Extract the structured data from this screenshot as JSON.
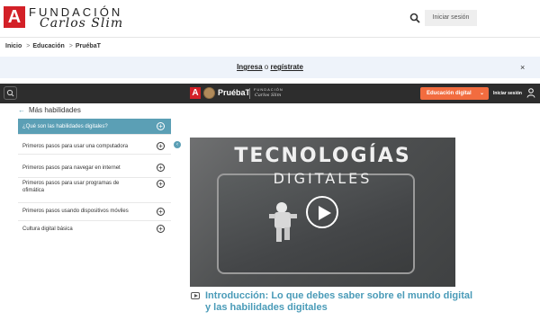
{
  "header": {
    "logo_letter": "A",
    "logo_line1": "FUNDACIÓN",
    "logo_line2": "Carlos Slim",
    "login_label": "Iniciar sesión"
  },
  "breadcrumb": [
    "Inicio",
    "Educación",
    "PruébaT"
  ],
  "banner": {
    "ingresa": "Ingresa",
    "o": "o",
    "registrate": "regístrate",
    "close": "×"
  },
  "nav": {
    "logo_letter": "A",
    "brand": "PruébaT",
    "fund_line1": "FUNDACIÓN",
    "fund_line2": "Carlos Slim",
    "edu_label": "Educación digital",
    "login_label": "Iniciar sesión"
  },
  "sidebar": {
    "back_label": "Más habilidades",
    "items": [
      {
        "label": "¿Qué son las habilidades digitales?",
        "active": true
      },
      {
        "label": "Primeros pasos para usar una computadora",
        "active": false
      },
      {
        "label": "Primeros pasos para navegar en internet",
        "active": false
      },
      {
        "label": "Primeros pasos para usar programas de ofimática",
        "active": false
      },
      {
        "label": "Primeros pasos usando dispositivos móviles",
        "active": false
      },
      {
        "label": "Cultura digital básica",
        "active": false
      }
    ]
  },
  "video": {
    "title_line1": "TECNOLOGÍAS",
    "title_line2": "DIGITALES",
    "caption": "Introducción: Lo que debes saber sobre el mundo digital y las habilidades digitales"
  },
  "colors": {
    "brand_red": "#d32027",
    "accent_teal": "#5b9fb5",
    "accent_orange": "#f26c3f",
    "nav_dark": "#2d2d2d",
    "caption_blue": "#4a9bb8"
  }
}
